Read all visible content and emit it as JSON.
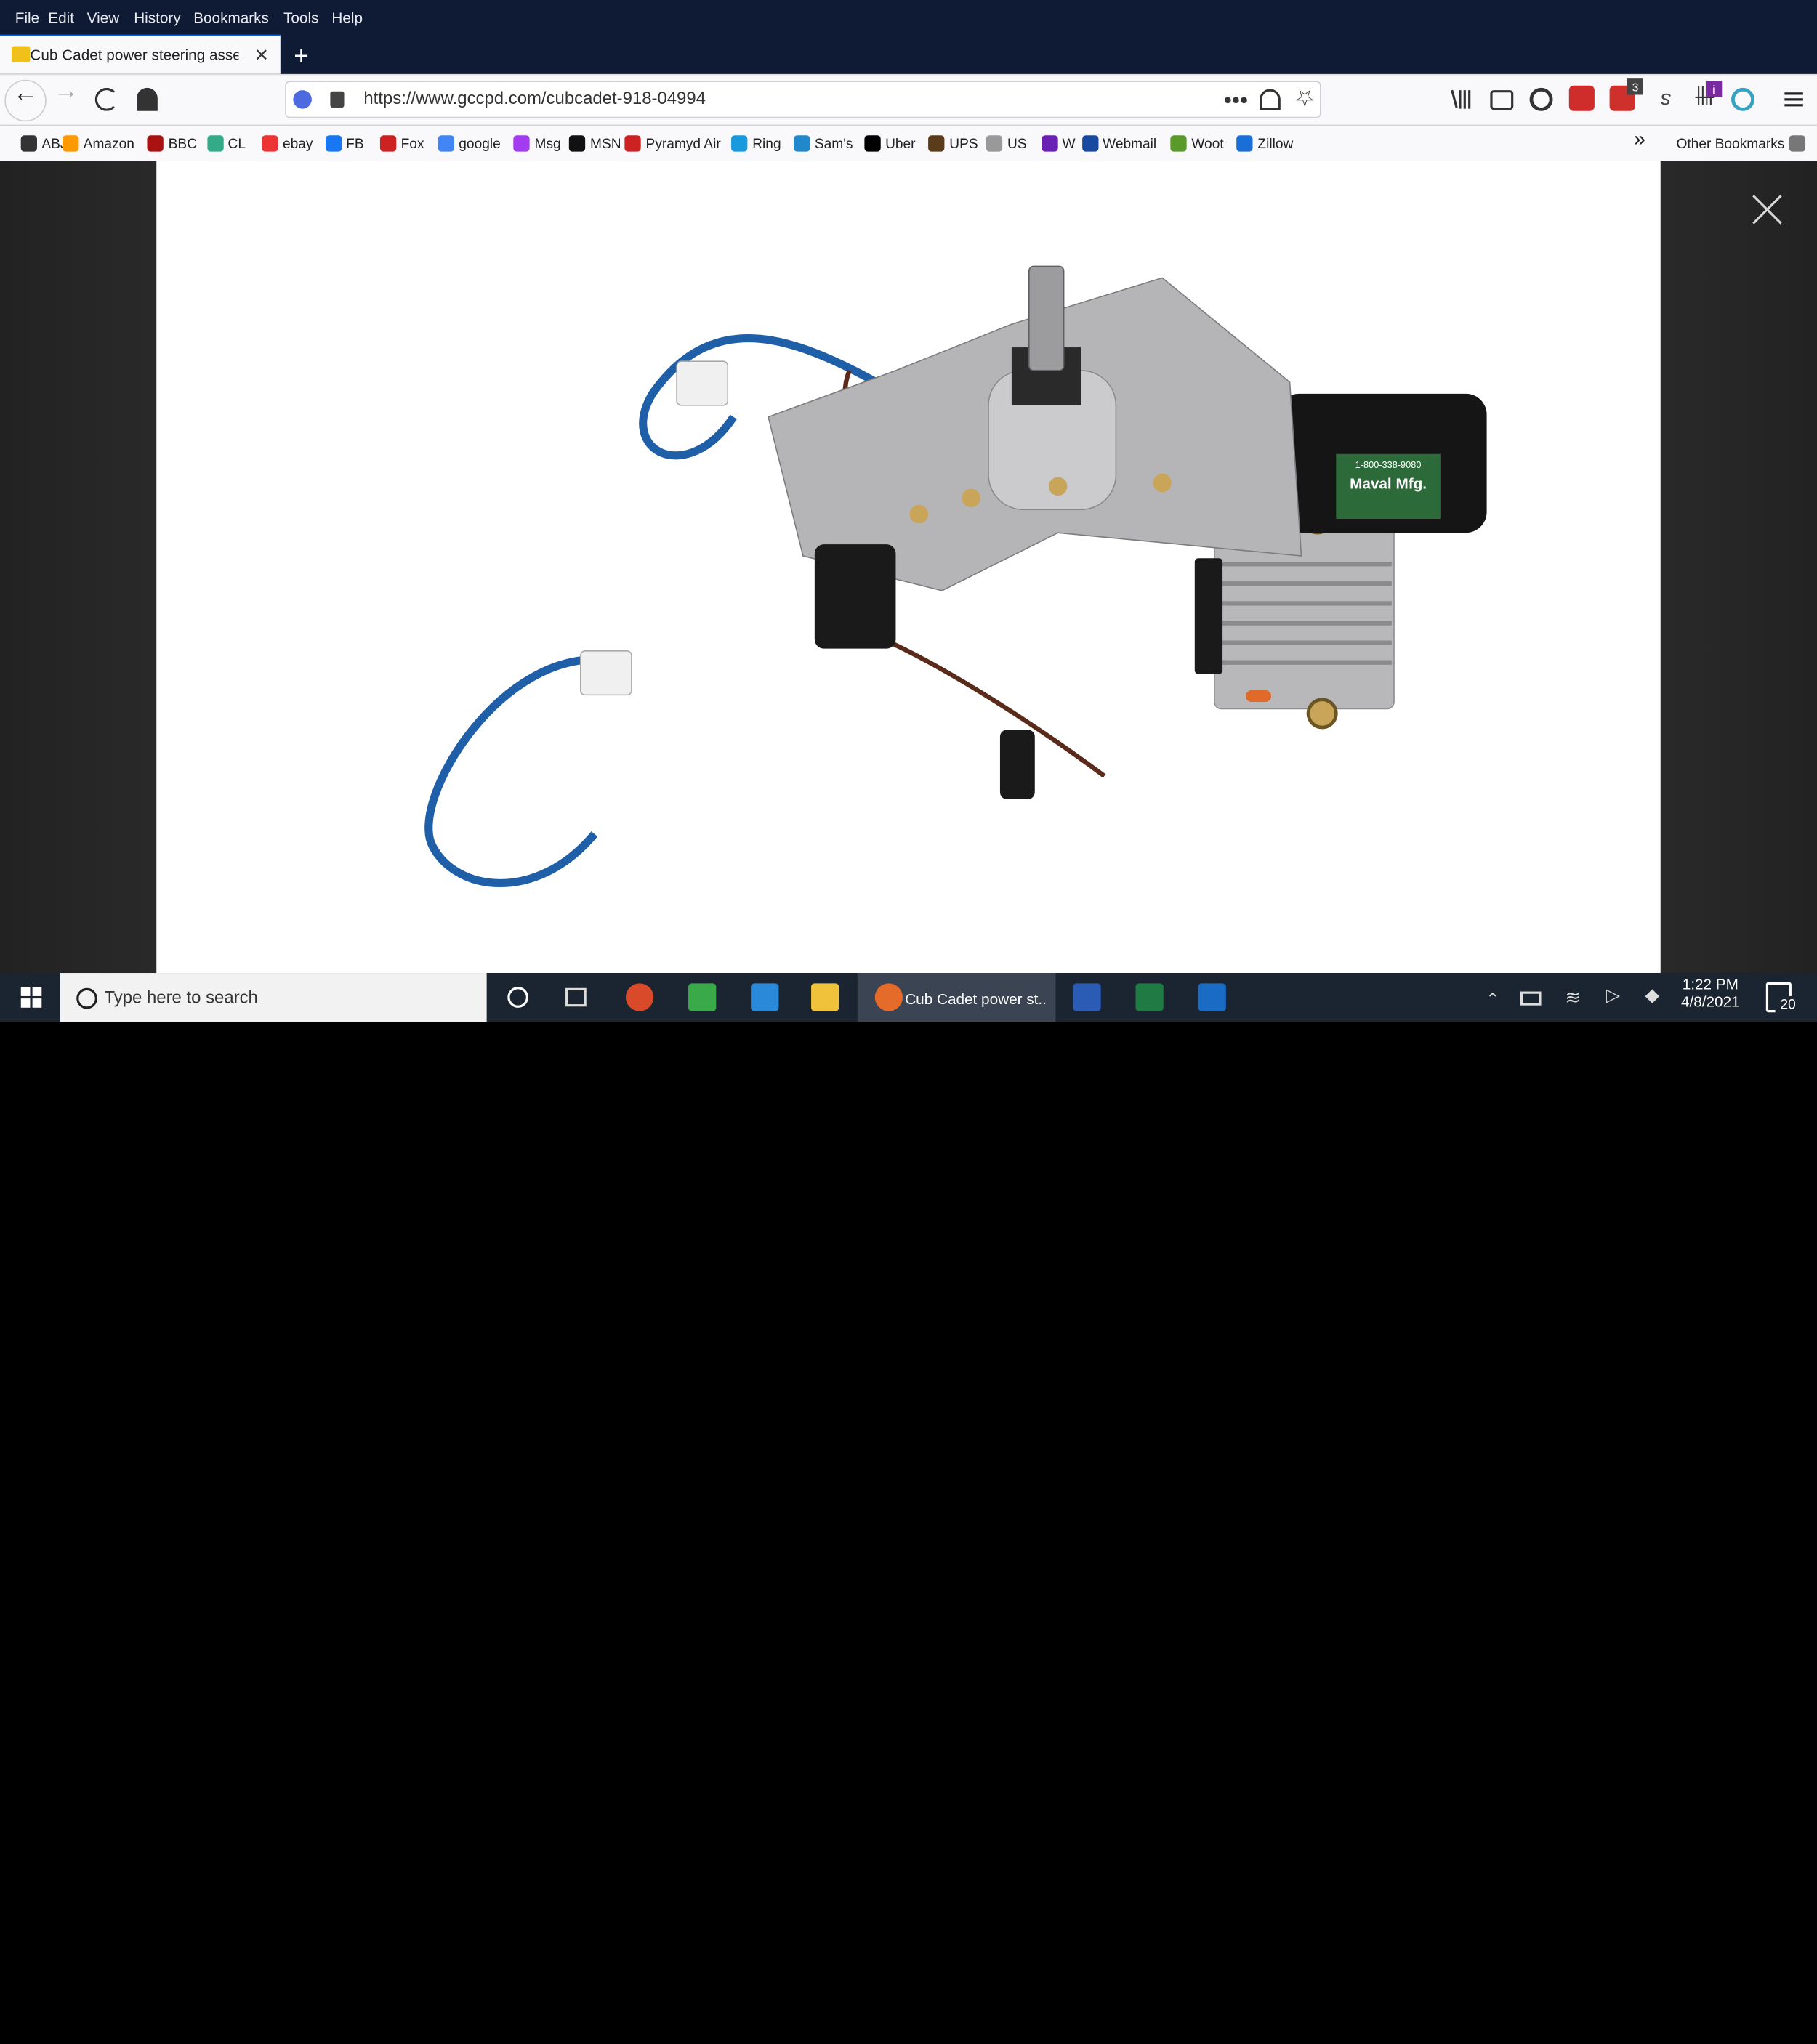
{
  "menu": {
    "file": "File",
    "edit": "Edit",
    "view": "View",
    "history": "History",
    "bookmarks": "Bookmarks",
    "tools": "Tools",
    "help": "Help"
  },
  "tab": {
    "title": "Cub Cadet power steering asse",
    "close": "✕",
    "new_tab": "+"
  },
  "window": {
    "minimize": "–",
    "restore": "⧉",
    "close": "✕"
  },
  "address": {
    "url": "https://www.gccpd.com/cubcadet-918-04994"
  },
  "bookmarks": [
    {
      "label": "ABJ",
      "icon": "abj-icon"
    },
    {
      "label": "Amazon",
      "icon": "amazon-icon"
    },
    {
      "label": "BBC",
      "icon": "bbc-icon"
    },
    {
      "label": "CL",
      "icon": "cl-icon"
    },
    {
      "label": "ebay",
      "icon": "ebay-icon"
    },
    {
      "label": "FB",
      "icon": "facebook-icon"
    },
    {
      "label": "Fox",
      "icon": "fox-icon"
    },
    {
      "label": "google",
      "icon": "google-icon"
    },
    {
      "label": "Msg",
      "icon": "messenger-icon"
    },
    {
      "label": "MSN",
      "icon": "msn-icon"
    },
    {
      "label": "Pyramyd Air",
      "icon": "pyramyd-icon"
    },
    {
      "label": "Ring",
      "icon": "ring-icon"
    },
    {
      "label": "Sam's",
      "icon": "sams-icon"
    },
    {
      "label": "Uber",
      "icon": "uber-icon"
    },
    {
      "label": "UPS",
      "icon": "ups-icon"
    },
    {
      "label": "US",
      "icon": "us-icon"
    },
    {
      "label": "W",
      "icon": "w-icon"
    },
    {
      "label": "Webmail",
      "icon": "webmail-icon"
    },
    {
      "label": "Woot",
      "icon": "woot-icon"
    },
    {
      "label": "Zillow",
      "icon": "zillow-icon"
    }
  ],
  "bookmarks_more": "»",
  "other_bookmarks": "Other Bookmarks",
  "extensions": {
    "abp_badge": "3",
    "info_badge": "i"
  },
  "taskbar": {
    "search_placeholder": "Type here to search",
    "active_app_label": "Cub Cadet power st...",
    "time": "1:22 PM",
    "date": "4/8/2021",
    "notifications": "20"
  },
  "product": {
    "motor_label": "Maval Mfg.",
    "motor_phone": "1-800-338-9080"
  },
  "colors": {
    "taskbar": "#1b2532",
    "browser_chrome": "#0f1a35",
    "toolbar": "#f9f9fb",
    "accent": "#0060df"
  }
}
